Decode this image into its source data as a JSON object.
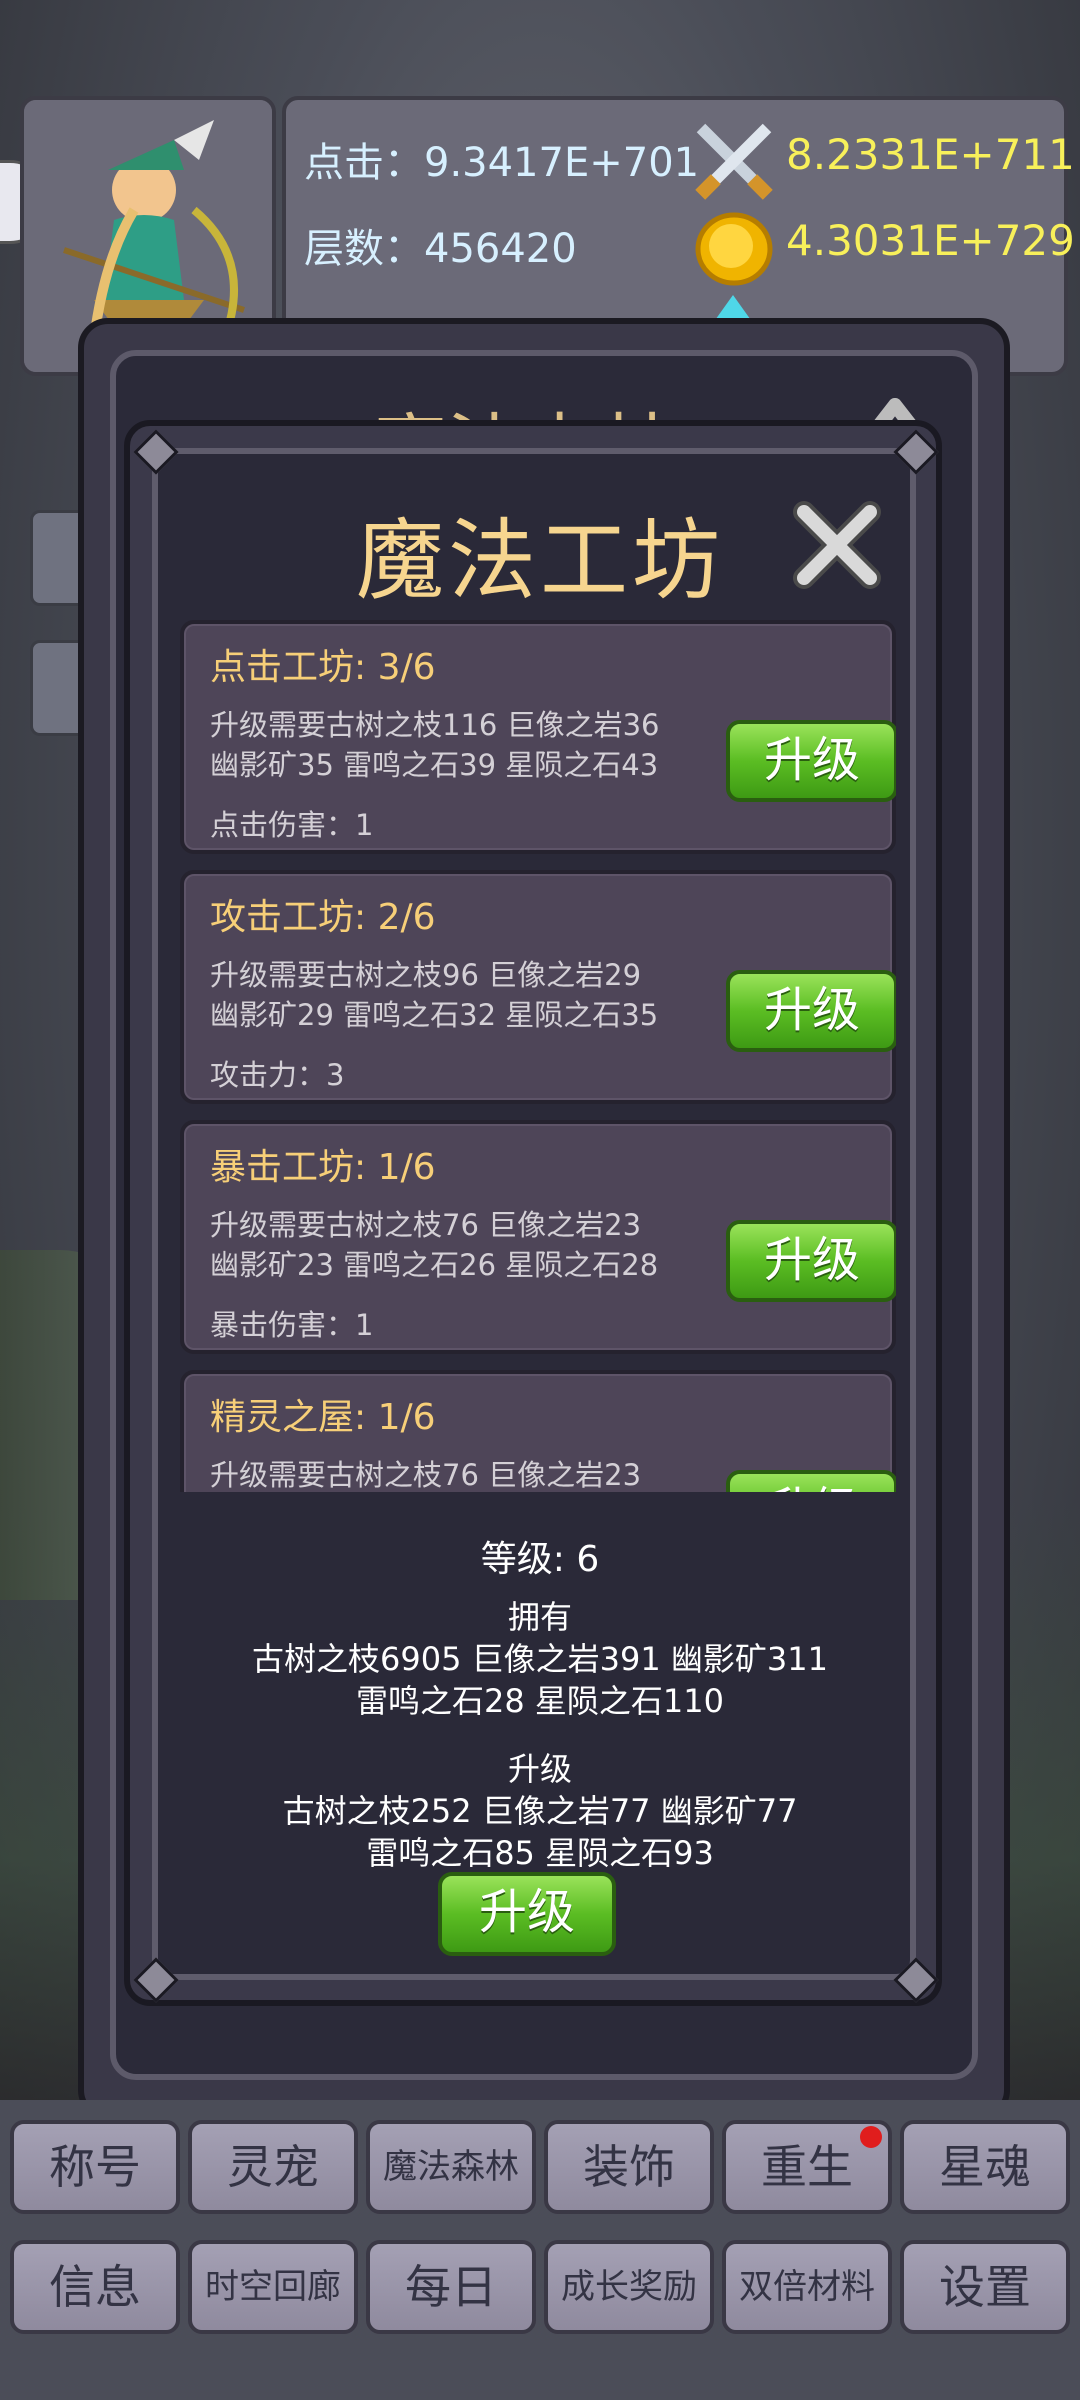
{
  "hud": {
    "click_label": "点击：9.3417E+701",
    "floor_label": "层数：456420",
    "attack_value": "8.2331E+711",
    "gold_value": "4.3031E+729"
  },
  "back_dialog": {
    "title": "魔法森林"
  },
  "workshop": {
    "title": "魔法工坊",
    "cards": [
      {
        "title": "点击工坊: 3/6",
        "req_line1": "升级需要古树之枝116   巨像之岩36",
        "req_line2": "幽影矿35  雷鸣之石39   星陨之石43",
        "stat": "点击伤害：1",
        "button": "升级"
      },
      {
        "title": "攻击工坊: 2/6",
        "req_line1": "升级需要古树之枝96   巨像之岩29",
        "req_line2": "幽影矿29  雷鸣之石32   星陨之石35",
        "stat": "攻击力：3",
        "button": "升级"
      },
      {
        "title": "暴击工坊: 1/6",
        "req_line1": "升级需要古树之枝76   巨像之岩23",
        "req_line2": "幽影矿23  雷鸣之石26   星陨之石28",
        "stat": "暴击伤害：1",
        "button": "升级"
      },
      {
        "title": "精灵之屋: 1/6",
        "req_line1": "升级需要古树之枝76   巨像之岩23",
        "button": "升级"
      }
    ],
    "level_label": "等级: 6",
    "owned_label": "拥有",
    "owned_line1": "古树之枝6905   巨像之岩391   幽影矿311",
    "owned_line2": "雷鸣之石28   星陨之石110",
    "upgrade_label": "升级",
    "upgrade_line1": "古树之枝252   巨像之岩77   幽影矿77",
    "upgrade_line2": "雷鸣之石85   星陨之石93",
    "upgrade_button": "升级"
  },
  "menu": {
    "row1": [
      "称号",
      "灵宠",
      "魔法森林",
      "装饰",
      "重生",
      "星魂"
    ],
    "row2": [
      "信息",
      "时空回廊",
      "每日",
      "成长奖励",
      "双倍材料",
      "设置"
    ]
  },
  "icons": {
    "attack": "crossed-swords-icon",
    "gold": "gold-coin-icon",
    "gem": "gem-icon",
    "close": "close-x-icon",
    "notification": "red-dot-icon"
  },
  "colors": {
    "title": "#f6d58f",
    "card_title": "#f7cf78",
    "button_green": "#5bbd23",
    "hud_value": "#f8f05a"
  }
}
